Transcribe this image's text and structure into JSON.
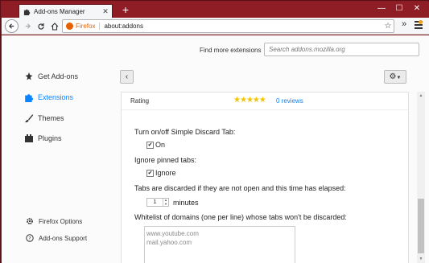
{
  "window": {
    "tab_title": "Add-ons Manager",
    "minimize": "—",
    "maximize": "☐",
    "close": "✕"
  },
  "navbar": {
    "browser_label": "Firefox",
    "url": "about:addons"
  },
  "header": {
    "find_more_label": "Find more extensions",
    "search_placeholder": "Search addons.mozilla.org"
  },
  "sidebar": {
    "items": [
      {
        "label": "Get Add-ons",
        "icon": "get-addons-icon"
      },
      {
        "label": "Extensions",
        "icon": "puzzle-icon",
        "active": true
      },
      {
        "label": "Themes",
        "icon": "brush-icon"
      },
      {
        "label": "Plugins",
        "icon": "plugin-icon"
      }
    ],
    "footer": [
      {
        "label": "Firefox Options",
        "icon": "gear-icon"
      },
      {
        "label": "Add-ons Support",
        "icon": "help-icon"
      }
    ]
  },
  "details": {
    "rating_label": "Rating",
    "rating_stars": 5,
    "reviews_link": "0 reviews",
    "options": {
      "discard_toggle": {
        "label": "Turn on/off Simple Discard Tab:",
        "checkbox_label": "On",
        "checked": true
      },
      "ignore_pinned": {
        "label": "Ignore pinned tabs:",
        "checkbox_label": "Ignore",
        "checked": true
      },
      "elapsed": {
        "label": "Tabs are discarded if they are not open and this time has elapsed:",
        "value": "1",
        "unit": "minutes"
      },
      "whitelist": {
        "label": "Whitelist of domains (one per line) whose tabs won't be discarded:",
        "lines": [
          "www.youtube.com",
          "mail.yahoo.com"
        ]
      }
    }
  },
  "colors": {
    "titlebar": "#8e1d26",
    "accent": "#0a84ff",
    "firefox_orange": "#e66000",
    "star": "#f4c400"
  }
}
